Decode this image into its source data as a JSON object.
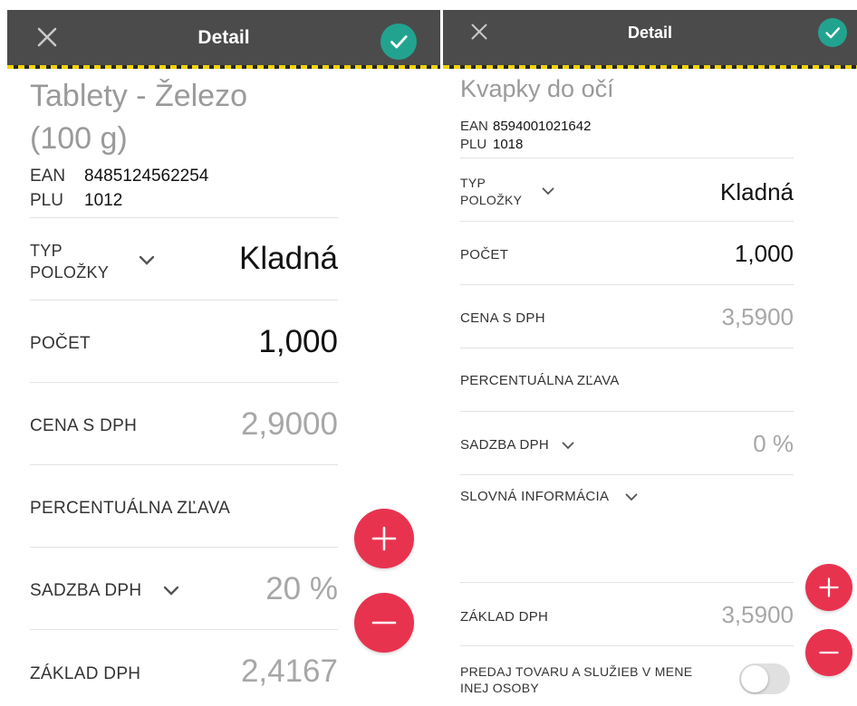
{
  "left": {
    "header": {
      "title": "Detail"
    },
    "item": {
      "name_line1": "Tablety - Železo",
      "name_line2": "(100 g)",
      "ean_label": "EAN",
      "ean": "8485124562254",
      "plu_label": "PLU",
      "plu": "1012"
    },
    "fields": {
      "typ_line1": "TYP",
      "typ_line2": "POLOŽKY",
      "typ_value": "Kladná",
      "pocet_label": "POČET",
      "pocet_value": "1,000",
      "cena_label": "CENA S DPH",
      "cena_value": "2,9000",
      "zlava_label": "PERCENTUÁLNA ZĽAVA",
      "sadzba_label": "SADZBA DPH",
      "sadzba_value": "20 %",
      "zaklad_label": "ZÁKLAD DPH",
      "zaklad_value": "2,4167"
    }
  },
  "right": {
    "header": {
      "title": "Detail"
    },
    "item": {
      "name": "Kvapky do očí",
      "ean_label": "EAN",
      "ean": "8594001021642",
      "plu_label": "PLU",
      "plu": "1018"
    },
    "fields": {
      "typ_line1": "TYP",
      "typ_line2": "POLOŽKY",
      "typ_value": "Kladná",
      "pocet_label": "POČET",
      "pocet_value": "1,000",
      "cena_label": "CENA S DPH",
      "cena_value": "3,5900",
      "zlava_label": "PERCENTUÁLNA ZĽAVA",
      "sadzba_label": "SADZBA DPH",
      "sadzba_value": "0 %",
      "slovna_label": "SLOVNÁ INFORMÁCIA",
      "zaklad_label": "ZÁKLAD DPH",
      "zaklad_value": "3,5900",
      "predaj_line1": "PREDAJ TOVARU A SLUŽIEB V MENE",
      "predaj_line2": "INEJ OSOBY",
      "predaj_toggle_on": false
    }
  },
  "icons": {
    "close": "close-icon",
    "confirm": "checkmark-icon",
    "chevron": "chevron-down-icon",
    "plus": "plus-icon",
    "minus": "minus-icon"
  },
  "colors": {
    "toolbar": "#4b4b4b",
    "stripe_yellow": "#f4d400",
    "confirm": "#22a38f",
    "fab": "#e8334f",
    "muted_value": "#a7a7a7"
  }
}
